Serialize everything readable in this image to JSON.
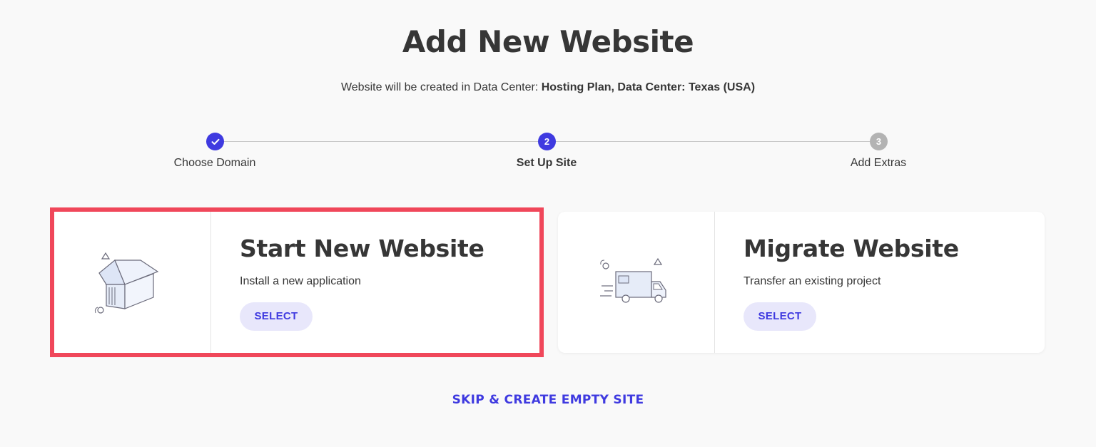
{
  "page": {
    "title": "Add New Website",
    "subtitle_prefix": "Website will be created in Data Center: ",
    "subtitle_value": "Hosting Plan, Data Center: Texas (USA)"
  },
  "stepper": {
    "steps": [
      {
        "label": "Choose Domain",
        "number": "",
        "state": "done"
      },
      {
        "label": "Set Up Site",
        "number": "2",
        "state": "current"
      },
      {
        "label": "Add Extras",
        "number": "3",
        "state": "pending"
      }
    ]
  },
  "cards": [
    {
      "title": "Start New Website",
      "description": "Install a new application",
      "button": "SELECT",
      "icon": "house-box-icon",
      "highlighted": true
    },
    {
      "title": "Migrate Website",
      "description": "Transfer an existing project",
      "button": "SELECT",
      "icon": "moving-truck-icon",
      "highlighted": false
    }
  ],
  "skip_link": "SKIP & CREATE EMPTY SITE",
  "colors": {
    "accent": "#3f3ae0",
    "highlight_border": "#f0475a",
    "button_bg": "#e8e7fb",
    "pending_step": "#b3b3b3"
  }
}
